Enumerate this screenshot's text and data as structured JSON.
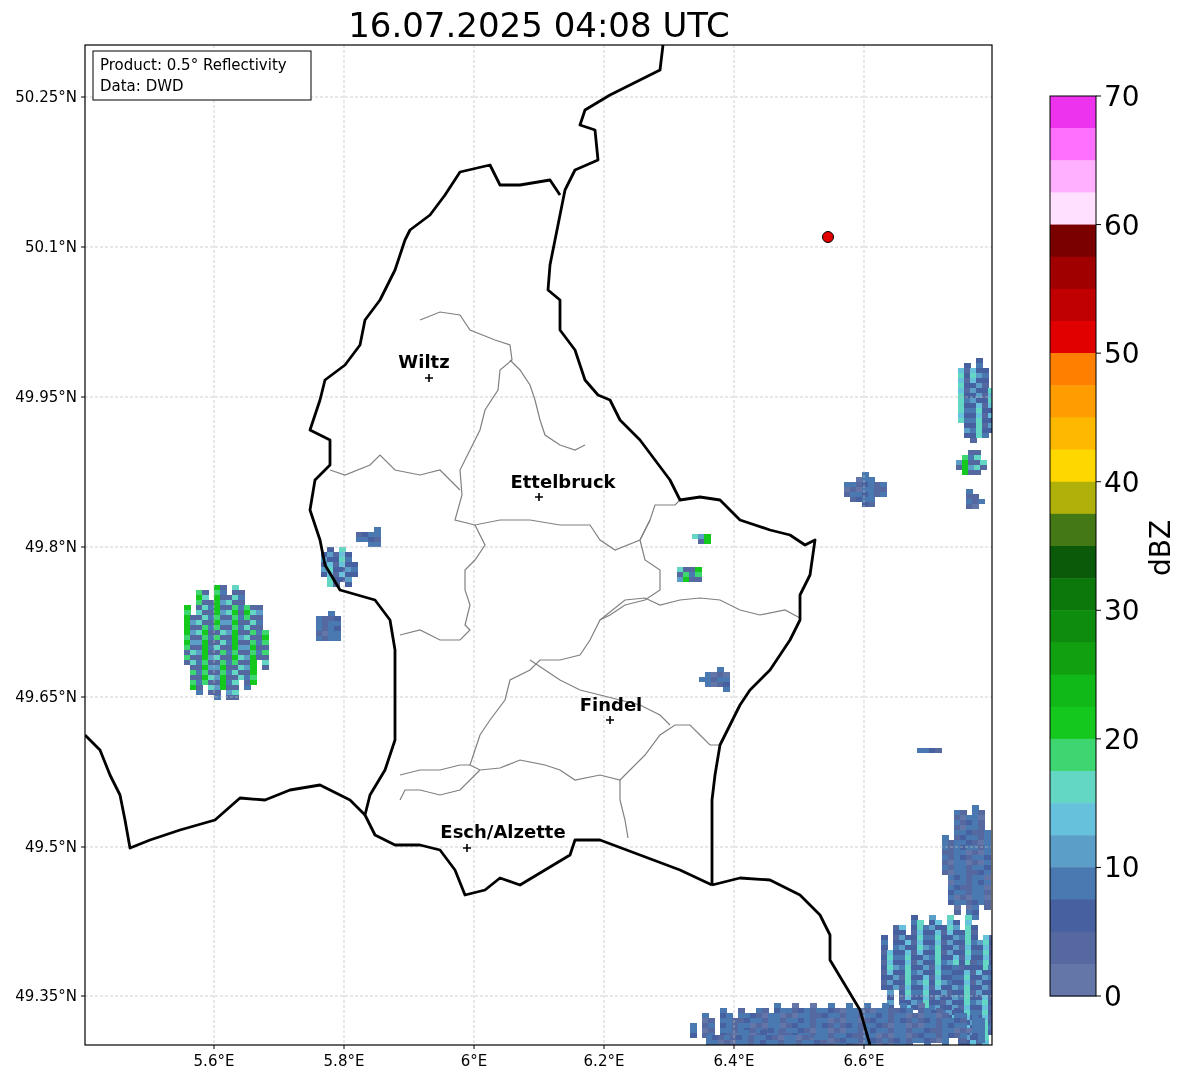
{
  "title": "16.07.2025 04:08 UTC",
  "info_box": {
    "lines": [
      "Product: 0.5° Reflectivity",
      "Data: DWD"
    ]
  },
  "axes": {
    "x_ticks": [
      "5.6°E",
      "5.8°E",
      "6°E",
      "6.2°E",
      "6.4°E",
      "6.6°E"
    ],
    "y_ticks": [
      "50.25°N",
      "50.1°N",
      "49.95°N",
      "49.8°N",
      "49.65°N",
      "49.5°N",
      "49.35°N"
    ]
  },
  "cities": [
    {
      "name": "Wiltz"
    },
    {
      "name": "Ettelbruck"
    },
    {
      "name": "Findel"
    },
    {
      "name": "Esch/Alzette"
    }
  ],
  "colorbar": {
    "label": "dBZ",
    "ticks": [
      "70",
      "60",
      "50",
      "40",
      "30",
      "20",
      "10",
      "0"
    ],
    "segments": [
      {
        "color": "#ee33ee"
      },
      {
        "color": "#ff70ff"
      },
      {
        "color": "#ffb0ff"
      },
      {
        "color": "#ffe0ff"
      },
      {
        "color": "#7a0000"
      },
      {
        "color": "#a00000"
      },
      {
        "color": "#c00000"
      },
      {
        "color": "#e00000"
      },
      {
        "color": "#ff8000"
      },
      {
        "color": "#ff9c00"
      },
      {
        "color": "#ffb800"
      },
      {
        "color": "#ffd700"
      },
      {
        "color": "#b0b00a"
      },
      {
        "color": "#447814"
      },
      {
        "color": "#0a5a0a"
      },
      {
        "color": "#0c780c"
      },
      {
        "color": "#0e8c0e"
      },
      {
        "color": "#10a010"
      },
      {
        "color": "#10b818"
      },
      {
        "color": "#14c81e"
      },
      {
        "color": "#3dd670"
      },
      {
        "color": "#63d6c4"
      },
      {
        "color": "#66c2dc"
      },
      {
        "color": "#5b9ec8"
      },
      {
        "color": "#4a78b0"
      },
      {
        "color": "#4660a0"
      },
      {
        "color": "#5668a0"
      },
      {
        "color": "#6475a8"
      }
    ]
  }
}
